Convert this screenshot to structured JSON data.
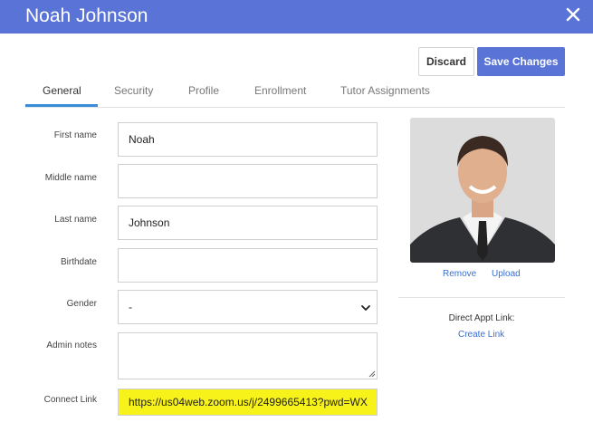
{
  "header": {
    "title": "Noah Johnson"
  },
  "actions": {
    "discard": "Discard",
    "save": "Save Changes"
  },
  "tabs": [
    {
      "label": "General",
      "active": true
    },
    {
      "label": "Security",
      "active": false
    },
    {
      "label": "Profile",
      "active": false
    },
    {
      "label": "Enrollment",
      "active": false
    },
    {
      "label": "Tutor Assignments",
      "active": false
    }
  ],
  "form": {
    "first_name": {
      "label": "First name",
      "value": "Noah"
    },
    "middle_name": {
      "label": "Middle name",
      "value": ""
    },
    "last_name": {
      "label": "Last name",
      "value": "Johnson"
    },
    "birthdate": {
      "label": "Birthdate",
      "value": ""
    },
    "gender": {
      "label": "Gender",
      "value": "-"
    },
    "admin_notes": {
      "label": "Admin notes",
      "value": ""
    },
    "connect_link": {
      "label": "Connect Link",
      "value": "https://us04web.zoom.us/j/2499665413?pwd=WX"
    }
  },
  "photo": {
    "remove": "Remove",
    "upload": "Upload"
  },
  "appt": {
    "label": "Direct Appt Link:",
    "create": "Create Link"
  },
  "colors": {
    "header": "#5a73d6",
    "accent": "#3a8dd8",
    "highlight": "#f7f21a"
  }
}
